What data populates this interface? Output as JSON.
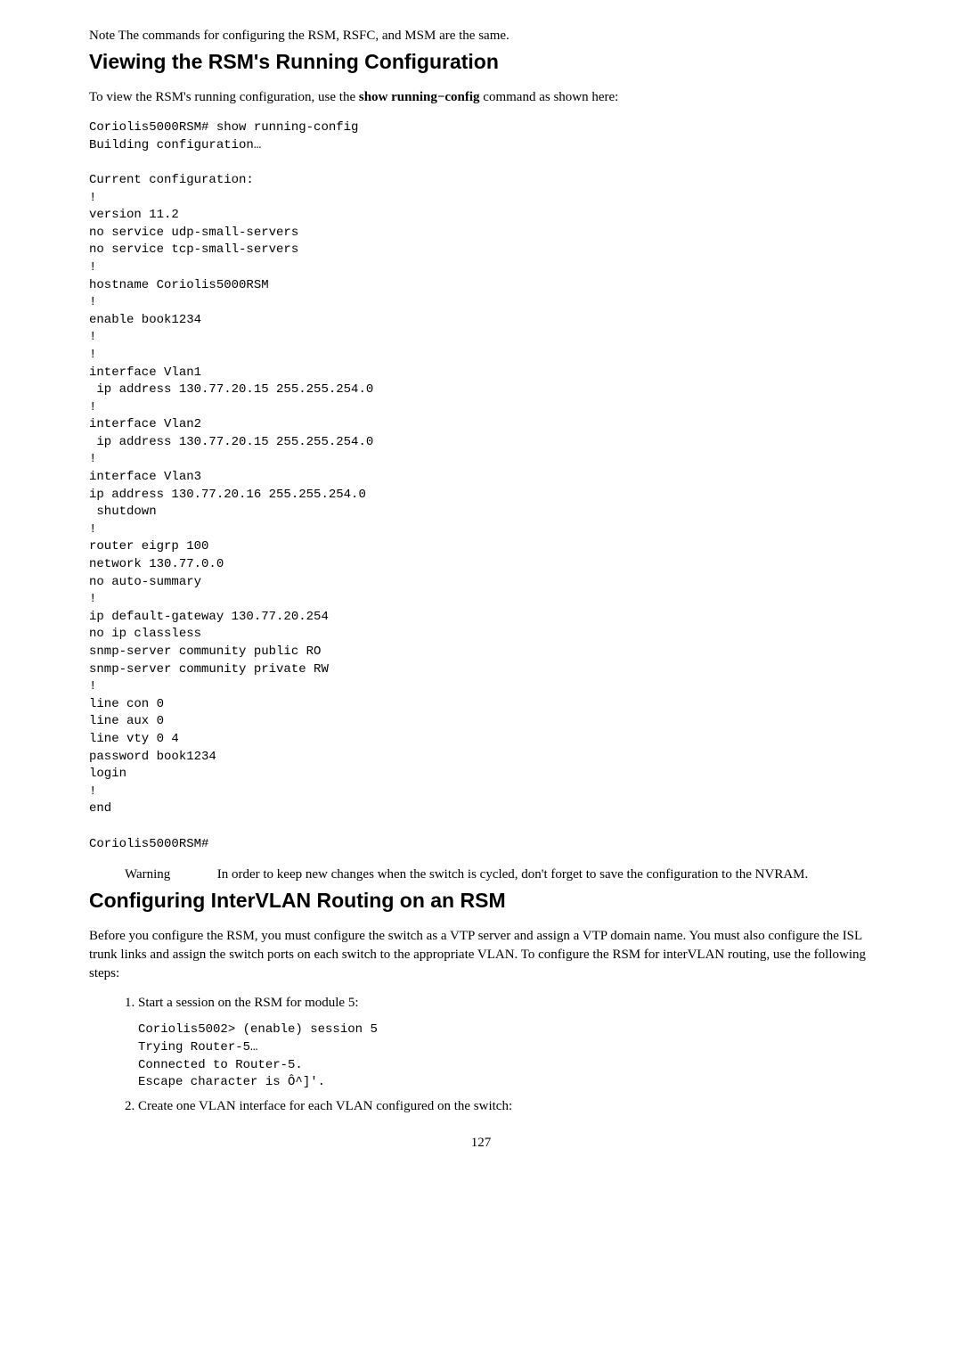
{
  "note": {
    "label": "Note",
    "text": "The commands for configuring the RSM, RSFC, and MSM are the same."
  },
  "section1": {
    "heading": "Viewing the RSM's Running Configuration",
    "intro_pre": "To view the RSM's running configuration, use the ",
    "intro_bold": "show running−config",
    "intro_post": " command as shown here:",
    "code": "Coriolis5000RSM# show running-config\nBuilding configuration…\n\nCurrent configuration:\n!\nversion 11.2\nno service udp-small-servers\nno service tcp-small-servers\n!\nhostname Coriolis5000RSM\n!\nenable book1234\n!\n!\ninterface Vlan1\n ip address 130.77.20.15 255.255.254.0\n!\ninterface Vlan2\n ip address 130.77.20.15 255.255.254.0\n!\ninterface Vlan3\nip address 130.77.20.16 255.255.254.0\n shutdown\n!\nrouter eigrp 100\nnetwork 130.77.0.0\nno auto-summary\n!\nip default-gateway 130.77.20.254\nno ip classless\nsnmp-server community public RO\nsnmp-server community private RW\n!\nline con 0\nline aux 0\nline vty 0 4\npassword book1234\nlogin\n!\nend\n\nCoriolis5000RSM#"
  },
  "warning": {
    "label": "Warning",
    "text": "In order to keep new changes when the switch is cycled, don't forget to save the configuration to the NVRAM."
  },
  "section2": {
    "heading": "Configuring InterVLAN Routing on an RSM",
    "para": "Before you configure the RSM, you must configure the switch as a VTP server and assign a VTP domain name. You must also configure the ISL trunk links and assign the switch ports on each switch to the appropriate VLAN. To configure the RSM for interVLAN routing, use the following steps:",
    "steps": [
      {
        "text": "Start a session on the RSM for module 5:",
        "code": "Coriolis5002> (enable) session 5\nTrying Router-5…\nConnected to Router-5.\nEscape character is Ô^]'."
      },
      {
        "text": "Create one VLAN interface for each VLAN configured on the switch:"
      }
    ]
  },
  "page_number": "127"
}
